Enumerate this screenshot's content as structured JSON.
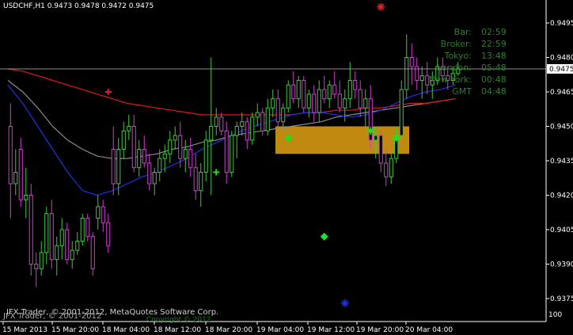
{
  "window": {
    "symbol": "USDCHF,H1",
    "ohlc": "0.9473 0.9478 0.9472 0.9475",
    "current_price_label": "0.9475",
    "copyright": "IFX Trader, © 2001-2012, MetaQuotes Software Corp.",
    "copyright_overlay": "ЈFX Trader, © 2001-2012",
    "copyright_extra": "Copyright © 2012",
    "corner_label": "100"
  },
  "clocks": [
    {
      "label": "Bar:",
      "value": "02:59"
    },
    {
      "label": "Broker:",
      "value": "22:59"
    },
    {
      "label": "Tokyo:",
      "value": "13:48"
    },
    {
      "label": "London:",
      "value": "05:48"
    },
    {
      "label": "New York:",
      "value": "00:48"
    },
    {
      "label": "GMT",
      "value": "04:48"
    }
  ],
  "colors": {
    "background": "#000000",
    "axis": "#ffffff",
    "bull": "#3fc93f",
    "bear": "#d03fd0",
    "ma_red": "#e01818",
    "ma_blue": "#2030e0",
    "ma_gray": "#8a8a8a",
    "zone": "#c08a10",
    "clock_text": "#2e7d2e"
  },
  "chart_data": {
    "type": "candlestick",
    "title": "USDCHF,H1",
    "ylim": [
      0.9365,
      0.9505
    ],
    "y_ticks": [
      "0.9495",
      "0.9480",
      "0.9465",
      "0.9450",
      "0.9435",
      "0.9420",
      "0.9405",
      "0.9390",
      "0.9375"
    ],
    "x_ticks": [
      "15 Mar 2013",
      "15 Mar 20:00",
      "18 Mar 04:00",
      "18 Mar 12:00",
      "18 Mar 20:00",
      "19 Mar 04:00",
      "19 Mar 12:00",
      "19 Mar 20:00",
      "20 Mar 04:00"
    ],
    "current_price": 0.9475,
    "candles": [
      [
        0.945,
        0.946,
        0.941,
        0.9425
      ],
      [
        0.9425,
        0.944,
        0.942,
        0.943
      ],
      [
        0.944,
        0.9445,
        0.9415,
        0.9418
      ],
      [
        0.9418,
        0.9432,
        0.941,
        0.942
      ],
      [
        0.942,
        0.9425,
        0.9385,
        0.939
      ],
      [
        0.939,
        0.9395,
        0.938,
        0.9388
      ],
      [
        0.9388,
        0.94,
        0.9385,
        0.9395
      ],
      [
        0.9395,
        0.9415,
        0.939,
        0.9412
      ],
      [
        0.9412,
        0.9418,
        0.9388,
        0.9392
      ],
      [
        0.9392,
        0.9402,
        0.9385,
        0.9398
      ],
      [
        0.9398,
        0.941,
        0.9392,
        0.9405
      ],
      [
        0.9405,
        0.9408,
        0.939,
        0.9392
      ],
      [
        0.9392,
        0.94,
        0.9388,
        0.9396
      ],
      [
        0.9396,
        0.9404,
        0.9394,
        0.94
      ],
      [
        0.94,
        0.9412,
        0.9398,
        0.941
      ],
      [
        0.941,
        0.9412,
        0.94,
        0.9402
      ],
      [
        0.9402,
        0.9404,
        0.9385,
        0.9388
      ],
      [
        0.941,
        0.942,
        0.9405,
        0.9415
      ],
      [
        0.9415,
        0.9418,
        0.9404,
        0.9408
      ],
      [
        0.9408,
        0.9412,
        0.9395,
        0.9398
      ],
      [
        0.944,
        0.945,
        0.942,
        0.9425
      ],
      [
        0.9425,
        0.9445,
        0.942,
        0.944
      ],
      [
        0.944,
        0.9452,
        0.9436,
        0.9448
      ],
      [
        0.9448,
        0.9455,
        0.9444,
        0.945
      ],
      [
        0.945,
        0.9455,
        0.943,
        0.9432
      ],
      [
        0.9432,
        0.9444,
        0.9428,
        0.944
      ],
      [
        0.944,
        0.9446,
        0.9432,
        0.9434
      ],
      [
        0.9434,
        0.9438,
        0.9422,
        0.9425
      ],
      [
        0.9425,
        0.9432,
        0.942,
        0.943
      ],
      [
        0.943,
        0.944,
        0.9426,
        0.9436
      ],
      [
        0.9436,
        0.9442,
        0.943,
        0.9438
      ],
      [
        0.9438,
        0.9448,
        0.9434,
        0.9444
      ],
      [
        0.9444,
        0.945,
        0.944,
        0.9446
      ],
      [
        0.9446,
        0.9452,
        0.9432,
        0.9436
      ],
      [
        0.9436,
        0.9444,
        0.943,
        0.944
      ],
      [
        0.944,
        0.9445,
        0.9428,
        0.9432
      ],
      [
        0.9432,
        0.9438,
        0.9418,
        0.9422
      ],
      [
        0.9422,
        0.9434,
        0.9415,
        0.943
      ],
      [
        0.943,
        0.9448,
        0.9426,
        0.9444
      ],
      [
        0.9444,
        0.948,
        0.942,
        0.945
      ],
      [
        0.945,
        0.9458,
        0.9446,
        0.9454
      ],
      [
        0.9454,
        0.9456,
        0.9446,
        0.9448
      ],
      [
        0.9448,
        0.9452,
        0.9425,
        0.943
      ],
      [
        0.943,
        0.9448,
        0.9428,
        0.9446
      ],
      [
        0.9446,
        0.9452,
        0.9436,
        0.945
      ],
      [
        0.945,
        0.9456,
        0.9446,
        0.9452
      ],
      [
        0.9452,
        0.9454,
        0.944,
        0.9444
      ],
      [
        0.9444,
        0.9456,
        0.9442,
        0.9454
      ],
      [
        0.9454,
        0.946,
        0.945,
        0.9456
      ],
      [
        0.9456,
        0.9458,
        0.9446,
        0.9448
      ],
      [
        0.9448,
        0.9462,
        0.9446,
        0.9458
      ],
      [
        0.9458,
        0.9466,
        0.9454,
        0.9462
      ],
      [
        0.9462,
        0.9466,
        0.945,
        0.9452
      ],
      [
        0.9452,
        0.946,
        0.9448,
        0.9458
      ],
      [
        0.9458,
        0.947,
        0.9456,
        0.9468
      ],
      [
        0.9468,
        0.9474,
        0.946,
        0.9462
      ],
      [
        0.9462,
        0.9472,
        0.9458,
        0.947
      ],
      [
        0.947,
        0.9472,
        0.9456,
        0.9458
      ],
      [
        0.9458,
        0.9466,
        0.9454,
        0.9464
      ],
      [
        0.9464,
        0.9468,
        0.9452,
        0.9456
      ],
      [
        0.9456,
        0.947,
        0.9452,
        0.9466
      ],
      [
        0.9466,
        0.9472,
        0.946,
        0.9462
      ],
      [
        0.9462,
        0.947,
        0.9458,
        0.9468
      ],
      [
        0.9468,
        0.9474,
        0.9462,
        0.9464
      ],
      [
        0.9464,
        0.947,
        0.9456,
        0.9458
      ],
      [
        0.9458,
        0.9466,
        0.9452,
        0.9462
      ],
      [
        0.9462,
        0.9478,
        0.9458,
        0.947
      ],
      [
        0.947,
        0.9474,
        0.9462,
        0.9466
      ],
      [
        0.9466,
        0.947,
        0.9454,
        0.9458
      ],
      [
        0.9458,
        0.9466,
        0.945,
        0.9462
      ],
      [
        0.9462,
        0.9468,
        0.944,
        0.9444
      ],
      [
        0.9444,
        0.945,
        0.9436,
        0.9446
      ],
      [
        0.9446,
        0.9448,
        0.943,
        0.9434
      ],
      [
        0.9434,
        0.944,
        0.9424,
        0.9428
      ],
      [
        0.9428,
        0.9438,
        0.9425,
        0.9436
      ],
      [
        0.9436,
        0.945,
        0.9434,
        0.9446
      ],
      [
        0.9446,
        0.947,
        0.9444,
        0.9466
      ],
      [
        0.9466,
        0.949,
        0.9462,
        0.948
      ],
      [
        0.948,
        0.9486,
        0.9468,
        0.9476
      ],
      [
        0.9476,
        0.948,
        0.9466,
        0.947
      ],
      [
        0.947,
        0.9476,
        0.9462,
        0.9472
      ],
      [
        0.9472,
        0.9478,
        0.9464,
        0.9468
      ],
      [
        0.9468,
        0.9474,
        0.9462,
        0.947
      ],
      [
        0.947,
        0.948,
        0.9468,
        0.9476
      ],
      [
        0.9476,
        0.948,
        0.947,
        0.9472
      ],
      [
        0.9472,
        0.9476,
        0.9466,
        0.947
      ],
      [
        0.947,
        0.9476,
        0.9468,
        0.9473
      ],
      [
        0.9473,
        0.9478,
        0.9472,
        0.9475
      ]
    ],
    "ma_red": [
      0.9475,
      0.9474,
      0.9472,
      0.947,
      0.9468,
      0.9466,
      0.9464,
      0.9462,
      0.946,
      0.9459,
      0.9458,
      0.9457,
      0.9456,
      0.9455,
      0.9455,
      0.9455,
      0.9455,
      0.9455,
      0.9455,
      0.9455,
      0.9456,
      0.9456,
      0.9457,
      0.9457,
      0.9458,
      0.9458,
      0.9459,
      0.946,
      0.946,
      0.9461,
      0.9462
    ],
    "ma_gray": [
      0.947,
      0.9465,
      0.9458,
      0.945,
      0.9444,
      0.944,
      0.9437,
      0.9436,
      0.9436,
      0.9437,
      0.9438,
      0.944,
      0.9441,
      0.9443,
      0.9444,
      0.9446,
      0.9447,
      0.9448,
      0.9449,
      0.945,
      0.9451,
      0.9452,
      0.9454,
      0.9455,
      0.9456,
      0.9457,
      0.9458,
      0.9459,
      0.946,
      0.9461,
      0.9462
    ],
    "ma_blue": [
      0.9468,
      0.946,
      0.945,
      0.944,
      0.943,
      0.9422,
      0.942,
      0.9422,
      0.9425,
      0.9428,
      0.943,
      0.9433,
      0.9436,
      0.944,
      0.9443,
      0.9446,
      0.9449,
      0.9451,
      0.9453,
      0.9455,
      0.9456,
      0.9456,
      0.9455,
      0.9454,
      0.9455,
      0.9457,
      0.946,
      0.9463,
      0.9465,
      0.9466,
      0.9468
    ],
    "zone": {
      "from_bar": 52,
      "to_bar": 78,
      "low": 0.9438,
      "high": 0.945
    },
    "markers": [
      {
        "kind": "star",
        "color": "#e02020",
        "bar": 72,
        "price": 0.9502
      },
      {
        "kind": "plus",
        "color": "#e02020",
        "bar": 19,
        "price": 0.9465
      },
      {
        "kind": "plus",
        "color": "#20e020",
        "bar": 40,
        "price": 0.943
      },
      {
        "kind": "star",
        "color": "#20e020",
        "bar": 54,
        "price": 0.9445
      },
      {
        "kind": "star",
        "color": "#20e020",
        "bar": 70,
        "price": 0.9448
      },
      {
        "kind": "diamond",
        "color": "#20e020",
        "bar": 75,
        "price": 0.9445
      },
      {
        "kind": "diamond",
        "color": "#20e020",
        "bar": 61,
        "price": 0.9402
      },
      {
        "kind": "star",
        "color": "#2030e0",
        "bar": 65,
        "price": 0.9373
      }
    ]
  }
}
